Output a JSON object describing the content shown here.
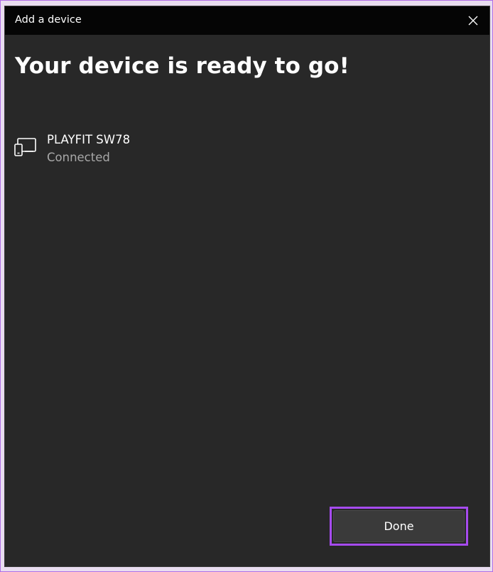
{
  "window": {
    "title": "Add a device",
    "close_icon": "close-icon"
  },
  "main": {
    "heading": "Your device is ready to go!"
  },
  "device": {
    "icon": "device-icon",
    "name": "PLAYFIT SW78",
    "status": "Connected"
  },
  "footer": {
    "done_label": "Done"
  },
  "colors": {
    "titlebar": "#050505",
    "dialog_bg": "#282828",
    "button_bg": "#3a3a3a",
    "highlight": "#a64bef",
    "secondary_text": "#a8a8a8"
  }
}
